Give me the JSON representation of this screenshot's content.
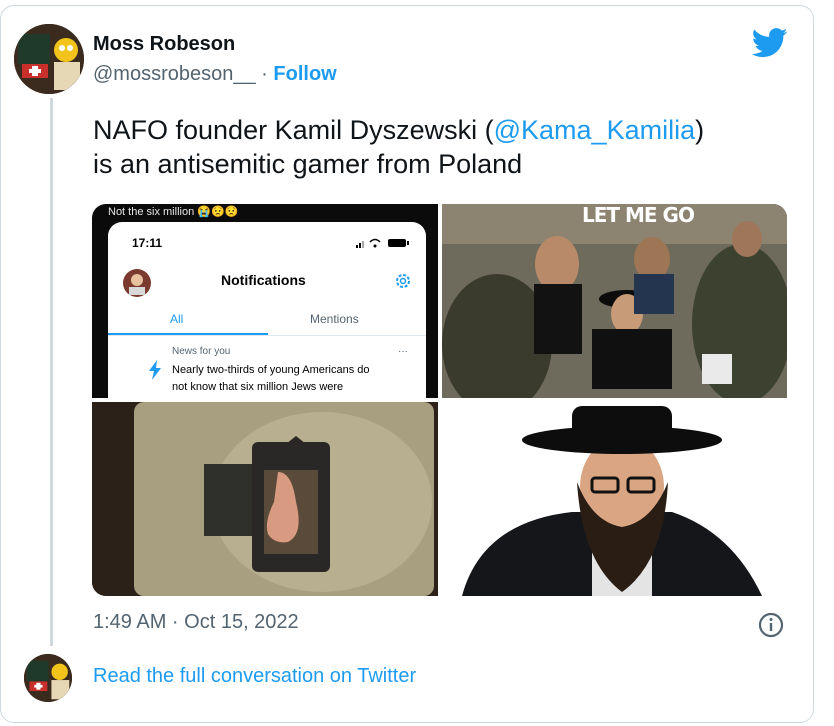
{
  "author": {
    "name": "Moss Robeson",
    "handle": "@mossrobeson__",
    "separator": "·",
    "follow_label": "Follow"
  },
  "tweet": {
    "text_before": "NAFO founder Kamil Dyszewski (",
    "mention": "@Kama_Kamilia",
    "text_after": ")",
    "line2": "is an antisemitic gamer from Poland"
  },
  "media": {
    "image1": {
      "caption": "Not the six million 😭😟😟",
      "time": "17:11",
      "title": "Notifications",
      "tab_all": "All",
      "tab_mentions": "Mentions",
      "category": "News for you",
      "dots": "···",
      "body_line1": "Nearly two-thirds of young Americans do",
      "body_line2": "not know that six million Jews were"
    },
    "image2": {
      "caption": "LET ME GO"
    }
  },
  "meta": {
    "timestamp": "1:49 AM · Oct 15, 2022",
    "read_full": "Read the full conversation on Twitter"
  },
  "colors": {
    "accent": "#1d9bf0",
    "text": "#0f1419",
    "secondary": "#536471",
    "border": "#cfd9de"
  },
  "icons": [
    "twitter-bird-icon",
    "info-icon",
    "lightning-icon",
    "gear-icon",
    "signal-icon",
    "wifi-icon",
    "battery-icon"
  ]
}
